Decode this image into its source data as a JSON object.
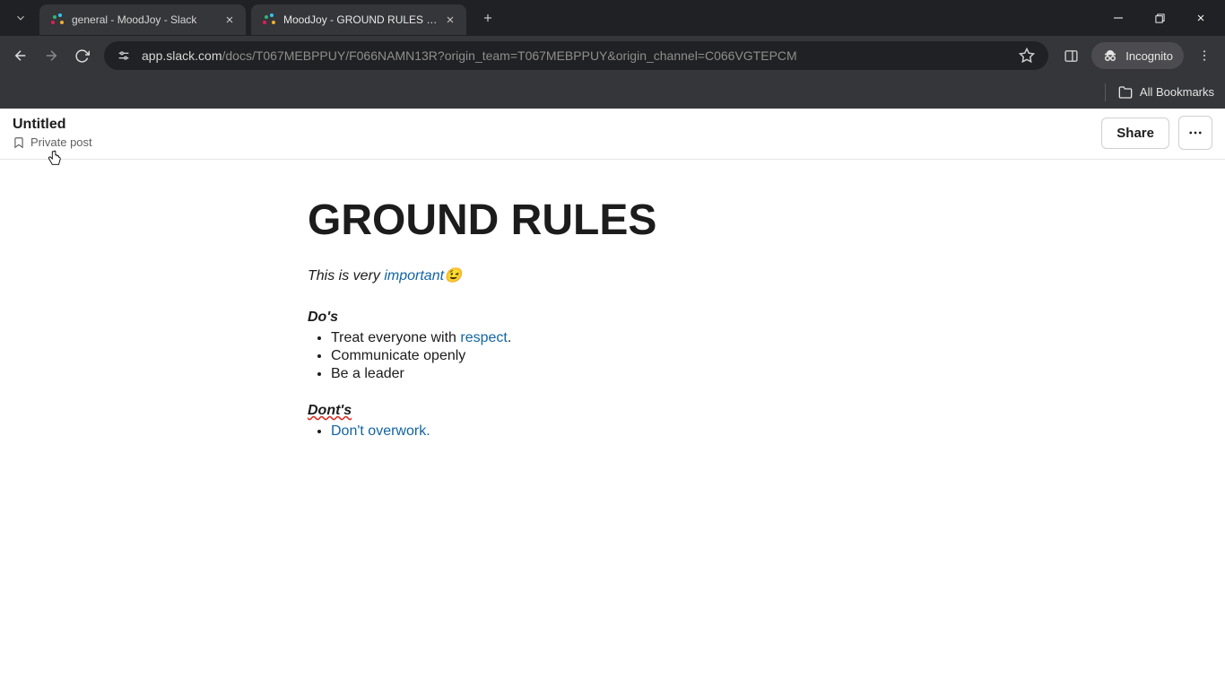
{
  "browser": {
    "tabs": [
      {
        "title": "general - MoodJoy - Slack",
        "active": false
      },
      {
        "title": "MoodJoy - GROUND RULES - S",
        "active": true
      }
    ],
    "url_host": "app.slack.com",
    "url_rest": "/docs/T067MEBPPUY/F066NAMN13R?origin_team=T067MEBPPUY&origin_channel=C066VGTEPCM",
    "incognito_label": "Incognito",
    "all_bookmarks": "All Bookmarks"
  },
  "doc": {
    "header_title": "Untitled",
    "privacy_label": "Private post",
    "share_label": "Share",
    "title": "GROUND RULES",
    "intro_prefix": "This is very ",
    "intro_link": "important",
    "intro_emoji": "😉",
    "dos_heading": "Do's",
    "dos_items": [
      {
        "prefix": "Treat everyone with ",
        "link": "respect",
        "suffix": "."
      },
      {
        "text": "Communicate openly"
      },
      {
        "text": "Be a leader"
      }
    ],
    "donts_heading": "Dont's",
    "donts_items": [
      {
        "link": "Don't overwork."
      }
    ]
  }
}
